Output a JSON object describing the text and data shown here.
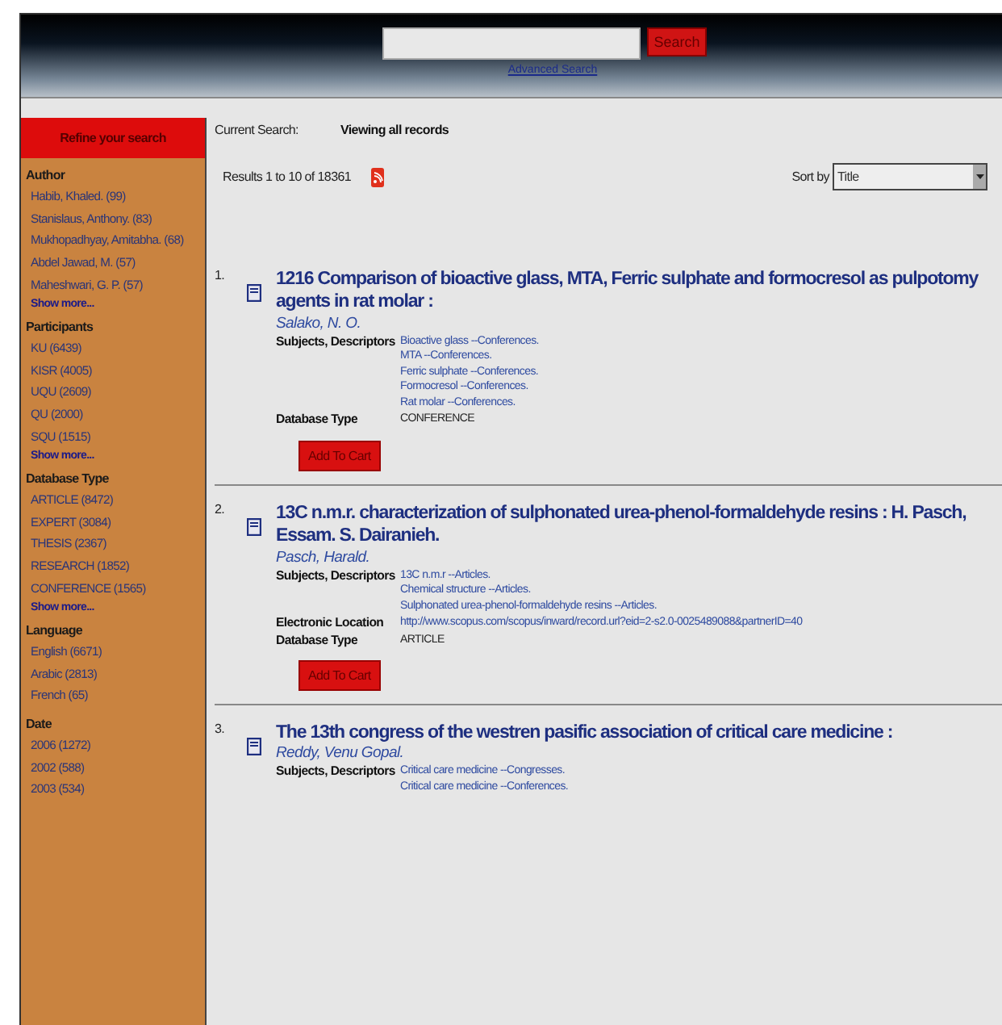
{
  "header": {
    "search_button": "Search",
    "advanced_link": "Advanced Search"
  },
  "sidebar": {
    "heading": "Refine your search",
    "facets": [
      {
        "title": "Author",
        "items": [
          "Habib, Khaled. (99)",
          "Stanislaus, Anthony. (83)",
          "Mukhopadhyay, Amitabha. (68)",
          "Abdel Jawad, M. (57)",
          "Maheshwari, G. P. (57)"
        ],
        "more": "Show more..."
      },
      {
        "title": "Participants",
        "items": [
          "KU (6439)",
          "KISR (4005)",
          "UQU (2609)",
          "QU (2000)",
          "SQU (1515)"
        ],
        "more": "Show more..."
      },
      {
        "title": "Database Type",
        "items": [
          "ARTICLE (8472)",
          "EXPERT (3084)",
          "THESIS (2367)",
          "RESEARCH (1852)",
          "CONFERENCE (1565)"
        ],
        "more": "Show more..."
      },
      {
        "title": "Language",
        "items": [
          "English (6671)",
          "Arabic (2813)",
          "French (65)"
        ]
      },
      {
        "title": "Date",
        "items": [
          "2006 (1272)",
          "2002 (588)",
          "2003 (534)"
        ]
      }
    ]
  },
  "main": {
    "current_search_label": "Current Search:",
    "current_search_value": "Viewing all records",
    "results_count": "Results 1 to 10 of 18361",
    "sort_label": "Sort by",
    "sort_value": "Title",
    "results": [
      {
        "number": "1.",
        "title": "1216 Comparison of bioactive glass, MTA, Ferric sulphate and formocresol as pulpotomy agents in rat molar :",
        "author": "Salako, N. O.",
        "fields": [
          {
            "label": "Subjects, Descriptors",
            "kind": "link",
            "values": [
              "Bioactive glass --Conferences.",
              "MTA --Conferences.",
              "Ferric sulphate --Conferences.",
              "Formocresol --Conferences.",
              "Rat molar --Conferences."
            ]
          },
          {
            "label": "Database Type",
            "kind": "text",
            "values": [
              "CONFERENCE"
            ]
          }
        ],
        "button": "Add To Cart"
      },
      {
        "number": "2.",
        "title": "13C n.m.r. characterization of sulphonated urea-phenol-formaldehyde resins : H. Pasch, Essam. S. Dairanieh.",
        "author": "Pasch, Harald.",
        "fields": [
          {
            "label": "Subjects, Descriptors",
            "kind": "link",
            "values": [
              "13C n.m.r --Articles.",
              "Chemical structure --Articles.",
              "Sulphonated urea-phenol-formaldehyde resins --Articles."
            ]
          },
          {
            "label": "Electronic Location",
            "kind": "link",
            "values": [
              "http://www.scopus.com/scopus/inward/record.url?eid=2-s2.0-0025489088&partnerID=40"
            ]
          },
          {
            "label": "Database Type",
            "kind": "text",
            "values": [
              "ARTICLE"
            ]
          }
        ],
        "button": "Add To Cart"
      },
      {
        "number": "3.",
        "title": "The 13th congress of the westren pasific association of critical care medicine :",
        "author": "Reddy, Venu Gopal.",
        "fields": [
          {
            "label": "Subjects, Descriptors",
            "kind": "link",
            "values": [
              "Critical care medicine --Congresses.",
              "Critical care medicine --Conferences."
            ]
          }
        ]
      }
    ]
  }
}
